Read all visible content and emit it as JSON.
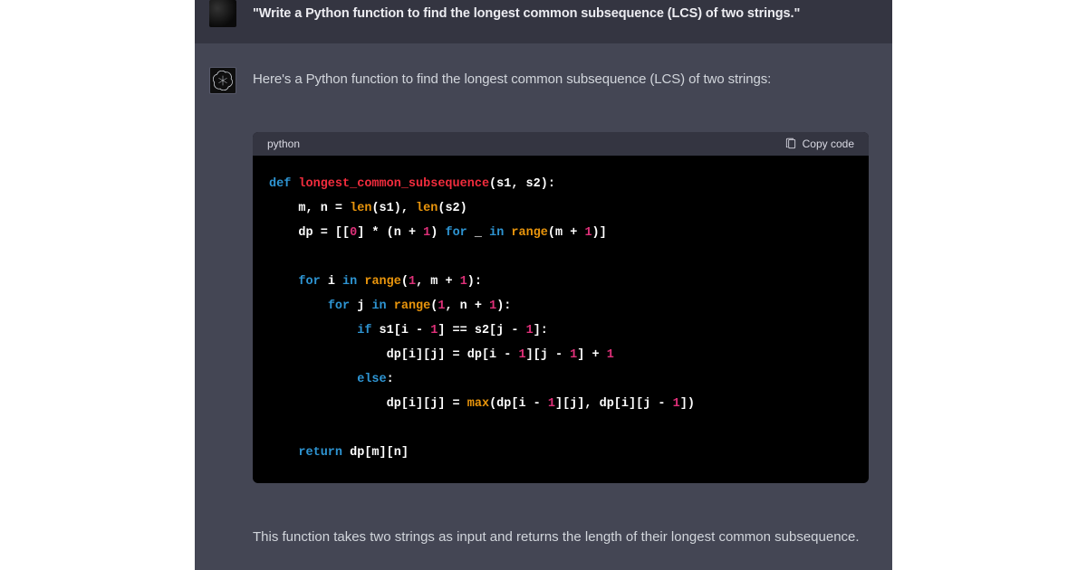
{
  "user": {
    "message": "\"Write a Python function to find the longest common subsequence (LCS) of two strings.\""
  },
  "assistant": {
    "intro": "Here's a Python function to find the longest common subsequence (LCS) of two strings:",
    "outro": "This function takes two strings as input and returns the length of their longest common subsequence.",
    "code": {
      "language": "python",
      "copy_label": "Copy code",
      "plain_source": "def longest_common_subsequence(s1, s2):\n    m, n = len(s1), len(s2)\n    dp = [[0] * (n + 1) for _ in range(m + 1)]\n\n    for i in range(1, m + 1):\n        for j in range(1, n + 1):\n            if s1[i - 1] == s2[j - 1]:\n                dp[i][j] = dp[i - 1][j - 1] + 1\n            else:\n                dp[i][j] = max(dp[i - 1][j], dp[i][j - 1])\n\n    return dp[m][n]",
      "tokens": [
        [
          [
            "def ",
            "kw"
          ],
          [
            "longest_common_subsequence",
            "fn"
          ],
          [
            "(",
            "p"
          ],
          [
            "s1, s2",
            "p"
          ],
          [
            "):",
            "p"
          ]
        ],
        [
          [
            "    m, n = ",
            "p"
          ],
          [
            "len",
            "bi"
          ],
          [
            "(s1), ",
            "p"
          ],
          [
            "len",
            "bi"
          ],
          [
            "(s2)",
            "p"
          ]
        ],
        [
          [
            "    dp = [[",
            "p"
          ],
          [
            "0",
            "num"
          ],
          [
            "] * (n + ",
            "p"
          ],
          [
            "1",
            "num"
          ],
          [
            ") ",
            "p"
          ],
          [
            "for",
            "kw"
          ],
          [
            " _ ",
            "p"
          ],
          [
            "in",
            "kw"
          ],
          [
            " ",
            "p"
          ],
          [
            "range",
            "bi"
          ],
          [
            "(m + ",
            "p"
          ],
          [
            "1",
            "num"
          ],
          [
            ")]",
            "p"
          ]
        ],
        [
          [
            "",
            "p"
          ]
        ],
        [
          [
            "    ",
            "p"
          ],
          [
            "for",
            "kw"
          ],
          [
            " i ",
            "p"
          ],
          [
            "in",
            "kw"
          ],
          [
            " ",
            "p"
          ],
          [
            "range",
            "bi"
          ],
          [
            "(",
            "p"
          ],
          [
            "1",
            "num"
          ],
          [
            ", m + ",
            "p"
          ],
          [
            "1",
            "num"
          ],
          [
            "):",
            "p"
          ]
        ],
        [
          [
            "        ",
            "p"
          ],
          [
            "for",
            "kw"
          ],
          [
            " j ",
            "p"
          ],
          [
            "in",
            "kw"
          ],
          [
            " ",
            "p"
          ],
          [
            "range",
            "bi"
          ],
          [
            "(",
            "p"
          ],
          [
            "1",
            "num"
          ],
          [
            ", n + ",
            "p"
          ],
          [
            "1",
            "num"
          ],
          [
            "):",
            "p"
          ]
        ],
        [
          [
            "            ",
            "p"
          ],
          [
            "if",
            "kw"
          ],
          [
            " s1[i - ",
            "p"
          ],
          [
            "1",
            "num"
          ],
          [
            "] == s2[j - ",
            "p"
          ],
          [
            "1",
            "num"
          ],
          [
            "]:",
            "p"
          ]
        ],
        [
          [
            "                dp[i][j] = dp[i - ",
            "p"
          ],
          [
            "1",
            "num"
          ],
          [
            "][j - ",
            "p"
          ],
          [
            "1",
            "num"
          ],
          [
            "] + ",
            "p"
          ],
          [
            "1",
            "num"
          ]
        ],
        [
          [
            "            ",
            "p"
          ],
          [
            "else",
            "kw"
          ],
          [
            ":",
            "p"
          ]
        ],
        [
          [
            "                dp[i][j] = ",
            "p"
          ],
          [
            "max",
            "bi"
          ],
          [
            "(dp[i - ",
            "p"
          ],
          [
            "1",
            "num"
          ],
          [
            "][j], dp[i][j - ",
            "p"
          ],
          [
            "1",
            "num"
          ],
          [
            "])",
            "p"
          ]
        ],
        [
          [
            "",
            "p"
          ]
        ],
        [
          [
            "    ",
            "p"
          ],
          [
            "return",
            "kw"
          ],
          [
            " dp[m][n]",
            "p"
          ]
        ]
      ]
    }
  }
}
